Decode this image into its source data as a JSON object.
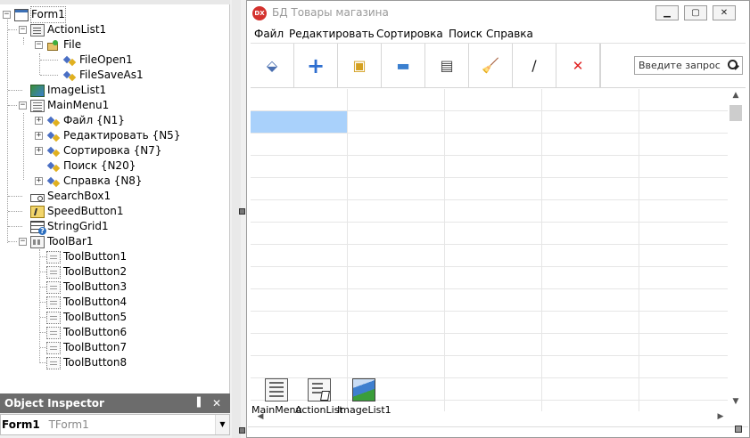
{
  "tree": {
    "nodes": [
      {
        "label": "Form1",
        "icon": "form-icon"
      },
      {
        "label": "ActionList1",
        "icon": "action-list-icon"
      },
      {
        "label": "File",
        "icon": "action-category-icon"
      },
      {
        "label": "FileOpen1",
        "icon": "action-icon"
      },
      {
        "label": "FileSaveAs1",
        "icon": "action-icon"
      },
      {
        "label": "ImageList1",
        "icon": "image-list-icon"
      },
      {
        "label": "MainMenu1",
        "icon": "main-menu-icon"
      },
      {
        "label": "Файл {N1}",
        "icon": "menu-item-icon"
      },
      {
        "label": "Редактировать {N5}",
        "icon": "menu-item-icon"
      },
      {
        "label": "Сортировка {N7}",
        "icon": "menu-item-icon"
      },
      {
        "label": "Поиск {N20}",
        "icon": "menu-item-icon"
      },
      {
        "label": "Справка {N8}",
        "icon": "menu-item-icon"
      },
      {
        "label": "SearchBox1",
        "icon": "search-box-icon"
      },
      {
        "label": "SpeedButton1",
        "icon": "speed-button-icon"
      },
      {
        "label": "StringGrid1",
        "icon": "string-grid-icon"
      },
      {
        "label": "ToolBar1",
        "icon": "toolbar-icon"
      },
      {
        "label": "ToolButton1",
        "icon": "tool-button-icon"
      },
      {
        "label": "ToolButton2",
        "icon": "tool-button-icon"
      },
      {
        "label": "ToolButton3",
        "icon": "tool-button-icon"
      },
      {
        "label": "ToolButton4",
        "icon": "tool-button-icon"
      },
      {
        "label": "ToolButton5",
        "icon": "tool-button-icon"
      },
      {
        "label": "ToolButton6",
        "icon": "tool-button-icon"
      },
      {
        "label": "ToolButton7",
        "icon": "tool-button-icon"
      },
      {
        "label": "ToolButton8",
        "icon": "tool-button-icon"
      }
    ]
  },
  "object_inspector": {
    "title": "Object Inspector",
    "selected_name": "Form1",
    "selected_type": "TForm1"
  },
  "form": {
    "app_icon_text": "DX",
    "title": "БД Товары магазина",
    "caption_buttons": [
      "minimize-icon",
      "maximize-icon",
      "close-icon"
    ],
    "menu": [
      "Файл",
      "Редактировать",
      "Сортировка",
      "Поиск",
      "Справка"
    ],
    "toolbar_icons": [
      {
        "name": "eraser-icon",
        "glyph": "⬙",
        "color": "#4a6fb0"
      },
      {
        "name": "add-icon",
        "glyph": "+",
        "color": "#2f6fd0"
      },
      {
        "name": "open-icon",
        "glyph": "▣",
        "color": "#d4a020"
      },
      {
        "name": "save-icon",
        "glyph": "▬",
        "color": "#3a7fcf"
      },
      {
        "name": "report-icon",
        "glyph": "▤",
        "color": "#444444"
      },
      {
        "name": "clear-icon",
        "glyph": "🧹",
        "color": "#e0a020"
      },
      {
        "name": "edit-icon",
        "glyph": "/",
        "color": "#222222"
      },
      {
        "name": "delete-icon",
        "glyph": "✕",
        "color": "#e02020"
      }
    ],
    "search_placeholder": "Введите запрос",
    "nonvisual_components": [
      {
        "label": "MainMenu",
        "icon": "main-menu-icon"
      },
      {
        "label": "ActionList",
        "icon": "action-list-icon"
      },
      {
        "label": "ImageList1",
        "icon": "image-list-icon"
      }
    ],
    "selection_color": "#a9d1fb"
  }
}
